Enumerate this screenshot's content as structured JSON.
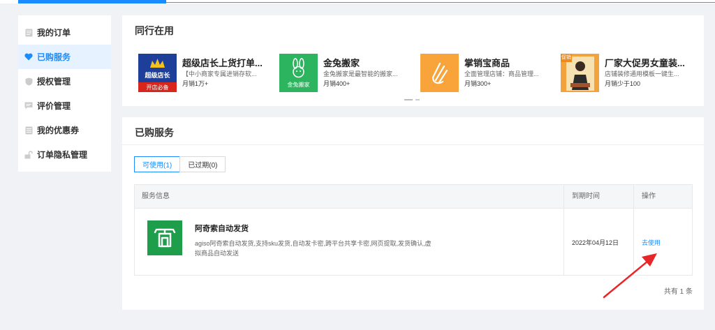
{
  "sidebar": {
    "items": [
      {
        "label": "我的订单",
        "icon": "document-icon"
      },
      {
        "label": "已购服务",
        "icon": "heart-icon",
        "active": true
      },
      {
        "label": "授权管理",
        "icon": "shield-icon"
      },
      {
        "label": "评价管理",
        "icon": "comment-icon"
      },
      {
        "label": "我的优惠券",
        "icon": "coupon-icon"
      },
      {
        "label": "订单隐私管理",
        "icon": "unlock-icon"
      }
    ]
  },
  "peers": {
    "title": "同行在用",
    "items": [
      {
        "name": "超级店长上货打单...",
        "desc": "【中小商家专属进销存软...",
        "sales": "月销1万+",
        "thumb_text_1": "超级店长",
        "thumb_text_2": "开店必备"
      },
      {
        "name": "金兔搬家",
        "desc": "金兔搬家是最智能的搬家...",
        "sales": "月销400+",
        "thumb_text": "金兔搬家"
      },
      {
        "name": "掌销宝商品",
        "desc": "全面管理店铺：商品管理...",
        "sales": "月销300+"
      },
      {
        "name": "厂家大促男女童装...",
        "desc": "店铺装修通用模板一键生...",
        "sales": "月销少于100",
        "thumb_badge": "促销"
      }
    ]
  },
  "purchased": {
    "title": "已购服务",
    "tabs": [
      "可使用(1)",
      "已过期(0)"
    ],
    "columns": [
      "服务信息",
      "到期时间",
      "操作"
    ],
    "rows": [
      {
        "name": "阿奇索自动发货",
        "desc": "agiso阿奇索自动发货,支持sku发货,自动发卡密,跨平台共享卡密,网页提取,发货确认,虚拟商品自动发送",
        "expire": "2022年04月12日",
        "action": "去使用"
      }
    ],
    "total": "共有 1 条"
  },
  "colors": {
    "accent": "#1a8cff",
    "service_green": "#1e9e4a",
    "arrow_red": "#e8262a"
  }
}
